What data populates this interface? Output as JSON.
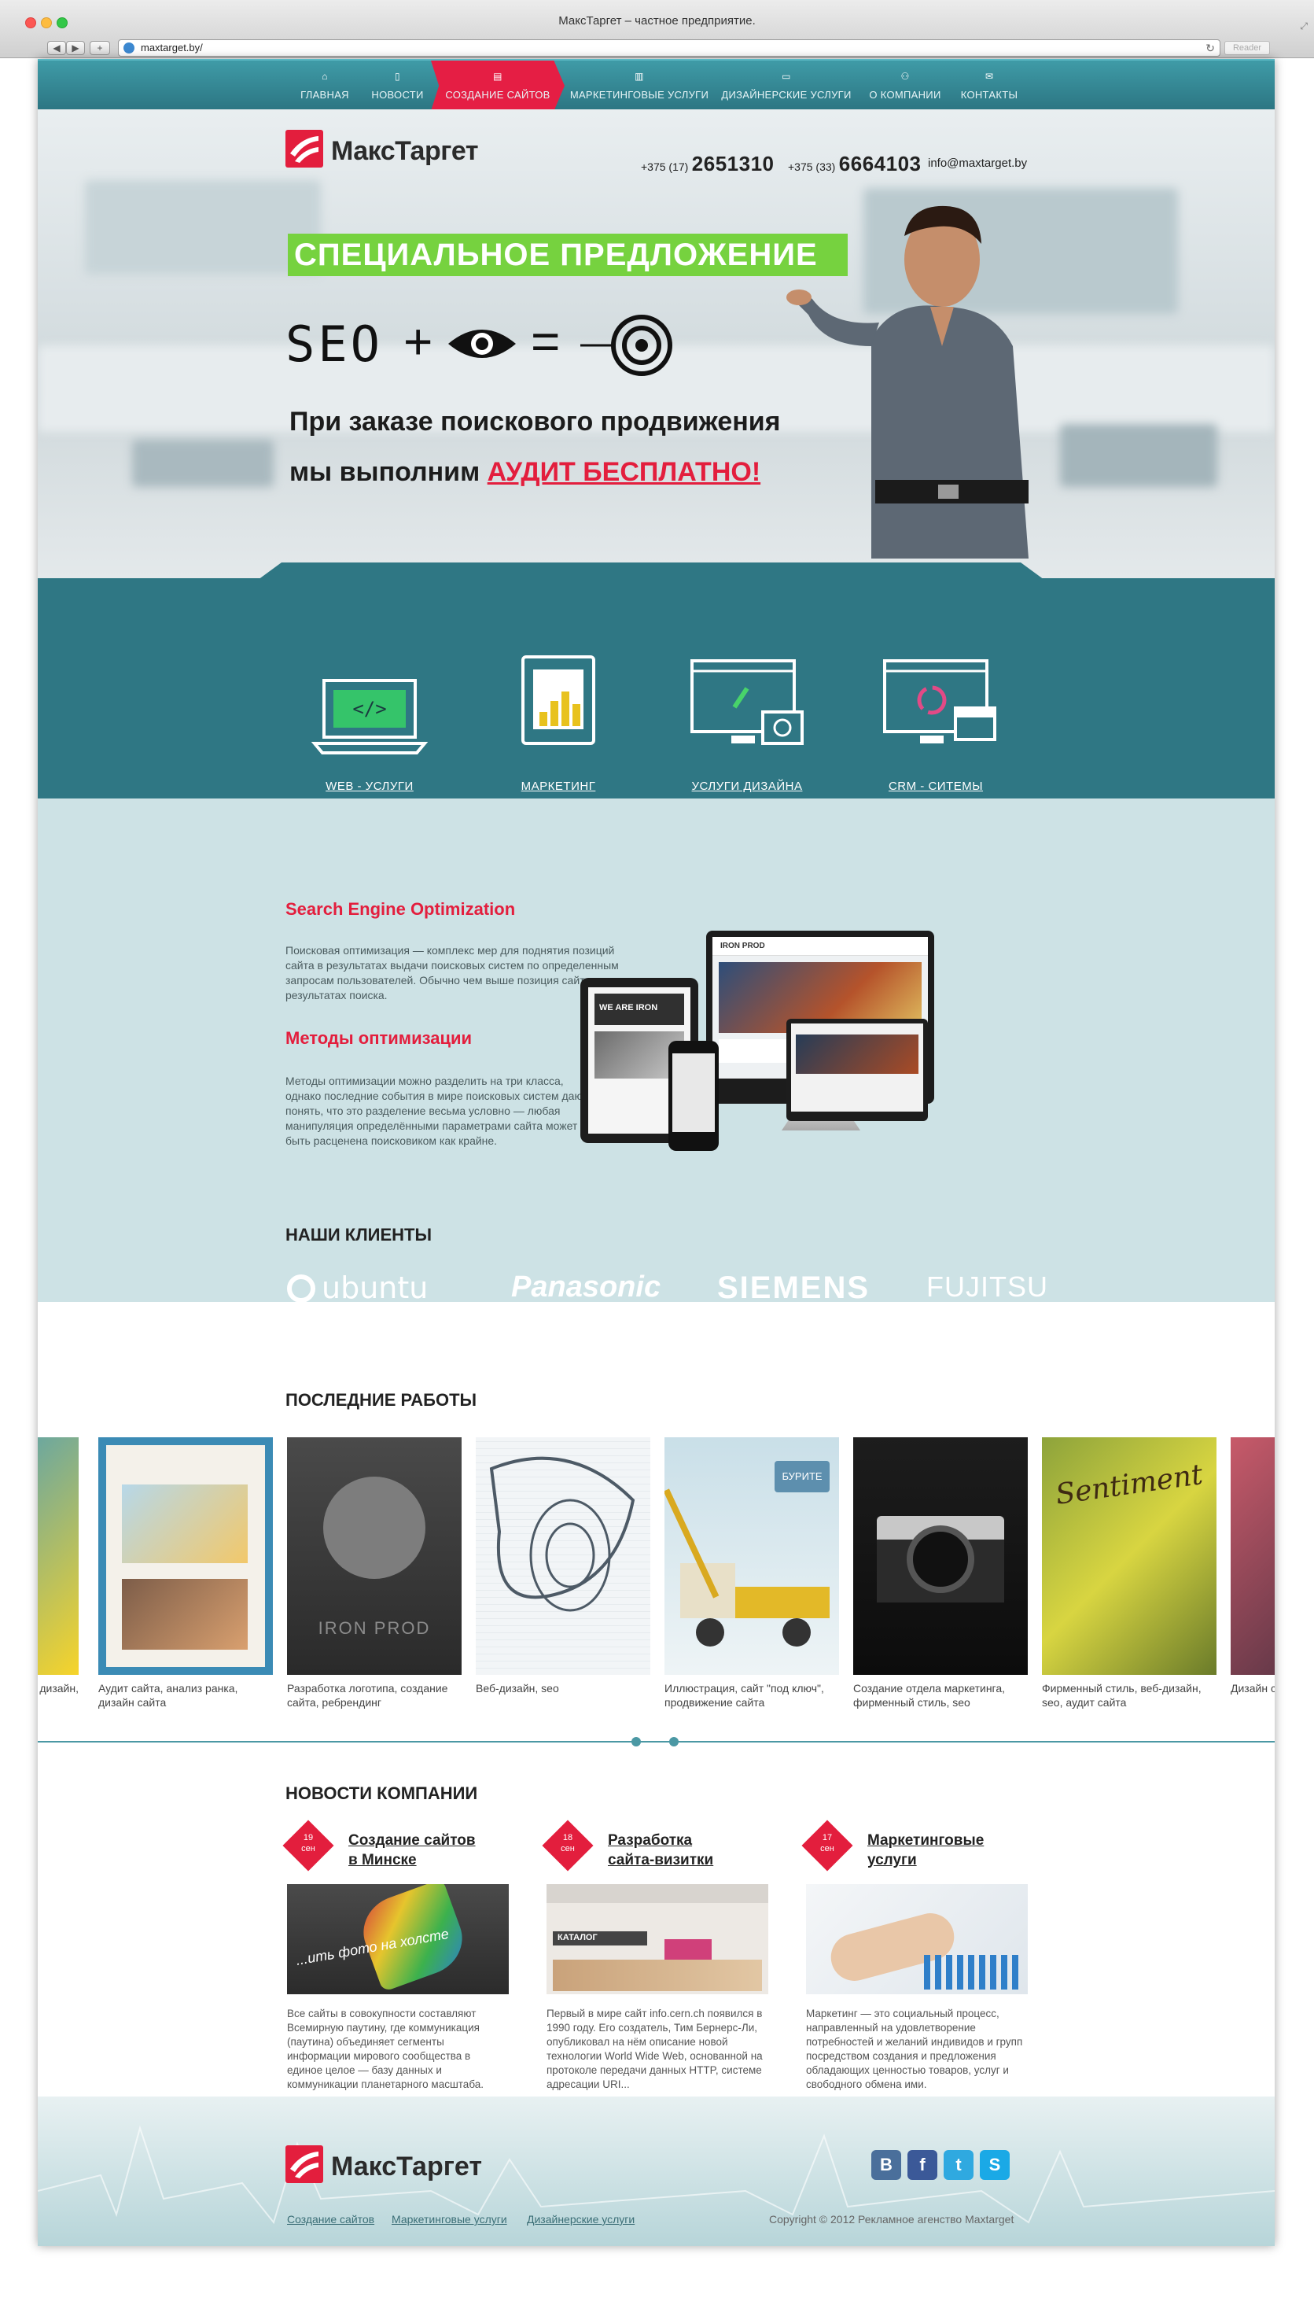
{
  "window": {
    "title": "МаксТаргет – частное предприятие.",
    "url": "maxtarget.by/",
    "reader": "Reader"
  },
  "nav": [
    {
      "label": "ГЛАВНАЯ",
      "icon": "home-icon"
    },
    {
      "label": "НОВОСТИ",
      "icon": "news-icon"
    },
    {
      "label": "СОЗДАНИЕ САЙТОВ",
      "icon": "site-icon",
      "active": true
    },
    {
      "label": "МАРКЕТИНГОВЫЕ УСЛУГИ",
      "icon": "chart-icon"
    },
    {
      "label": "ДИЗАЙНЕРСКИЕ УСЛУГИ",
      "icon": "monitor-icon"
    },
    {
      "label": "О КОМПАНИИ",
      "icon": "people-icon"
    },
    {
      "label": "КОНТАКТЫ",
      "icon": "mail-icon"
    }
  ],
  "header": {
    "logo": "МаксТаргет",
    "phone1_prefix": "+375 (17)",
    "phone1": "2651310",
    "phone2_prefix": "+375 (33)",
    "phone2": "6664103",
    "email": "info@maxtarget.by"
  },
  "hero": {
    "special": "СПЕЦИАЛЬНОЕ ПРЕДЛОЖЕНИЕ",
    "formula_seo": "SEO",
    "line1": "При заказе поискового продвижения",
    "line2": "мы выполним",
    "line2_red": "АУДИТ БЕСПЛАТНО!"
  },
  "services": [
    {
      "label": "WEB - УСЛУГИ",
      "icon": "code-laptop-icon"
    },
    {
      "label": "МАРКЕТИНГ",
      "icon": "bar-chart-tablet-icon"
    },
    {
      "label": "УСЛУГИ ДИЗАЙНА",
      "icon": "design-monitor-icon"
    },
    {
      "label": "CRM - СИТЕМЫ",
      "icon": "crm-monitor-icon"
    }
  ],
  "seo": {
    "heading1": "Search Engine Optimization",
    "text1": "Поисковая оптимизация — комплекс мер для поднятия позиций сайта в результатах выдачи поисковых систем по определенным запросам пользователей. Обычно чем выше позиция сайта в результатах поиска.",
    "heading2": "Методы оптимизации",
    "text2": "Методы оптимизации можно разделить на три класса, однако последние события в мире поисковых систем дают понять, что это разделение весьма условно — любая манипуляция определёнными параметрами сайта может быть расценена поисковиком как крайне.",
    "devices_label": "IRON PROD",
    "devices_banner": "WE ARE IRON"
  },
  "clients": {
    "heading": "НАШИ КЛИЕНТЫ",
    "logos": [
      "ubuntu",
      "Panasonic",
      "SIEMENS",
      "FUJITSU"
    ]
  },
  "works": {
    "heading": "ПОСЛЕДНИЕ РАБОТЫ",
    "items": [
      {
        "caption": "дизайн,"
      },
      {
        "caption": "Аудит сайта, анализ ранка, дизайн сайта"
      },
      {
        "caption": "Разработка логотипа, создание сайта, ребрендинг",
        "overlay": "IRON PROD"
      },
      {
        "caption": "Веб-дизайн, seo"
      },
      {
        "caption": "Иллюстрация, сайт \"под ключ\", продвижение сайта",
        "overlay": "БУРИТЕ"
      },
      {
        "caption": "Создание отдела маркетинга, фирменный стиль, seo"
      },
      {
        "caption": "Фирменный стиль, веб-дизайн, seo, аудит сайта",
        "overlay": "Sentiment"
      },
      {
        "caption": "Дизайн с"
      }
    ]
  },
  "news": {
    "heading": "НОВОСТИ КОМПАНИИ",
    "items": [
      {
        "day": "19",
        "month": "сен",
        "title1": "Создание сайтов",
        "title2": "в Минске",
        "text": "Все сайты в совокупности составляют Всемирную паутину, где коммуникация (паутина) объединяет сегменты информации мирового сообщества в единое целое — базу данных и коммуникации планетарного масштаба.",
        "pic_text": "...ить фото на холсте"
      },
      {
        "day": "18",
        "month": "сен",
        "title1": "Разработка",
        "title2": "сайта-визитки",
        "text": "Первый в мире сайт info.cern.ch появился в 1990 году. Его создатель, Тим Бернерс-Ли, опубликовал на нём описание новой технологии World Wide Web, основанной на протоколе передачи данных HTTP, системе адресации URI...",
        "pic_text": "КАТАЛОГ"
      },
      {
        "day": "17",
        "month": "сен",
        "title1": "Маркетинговые",
        "title2": "услуги",
        "text": "Маркетинг — это социальный процесс, направленный на удовлетворение потребностей и желаний индивидов и групп посредством создания и предложения обладающих ценностью товаров, услуг и свободного обмена ими."
      }
    ]
  },
  "footer": {
    "logo": "МаксТаргет",
    "links": [
      "Создание сайтов",
      "Маркетинговые услуги",
      "Дизайнерские услуги"
    ],
    "copyright": "Copyright © 2012 Рекламное агенство Maxtarget",
    "social": [
      {
        "letter": "B",
        "icon": "vk-icon",
        "color": "#4a6f9b"
      },
      {
        "letter": "f",
        "icon": "facebook-icon",
        "color": "#3b5998"
      },
      {
        "letter": "t",
        "icon": "twitter-icon",
        "color": "#2fa9e0"
      },
      {
        "letter": "S",
        "icon": "skype-icon",
        "color": "#1aa9e6"
      }
    ]
  },
  "colors": {
    "accent": "#e31e3d",
    "teal": "#2f7784",
    "green": "#76d23f",
    "light_teal": "#cde2e5"
  }
}
